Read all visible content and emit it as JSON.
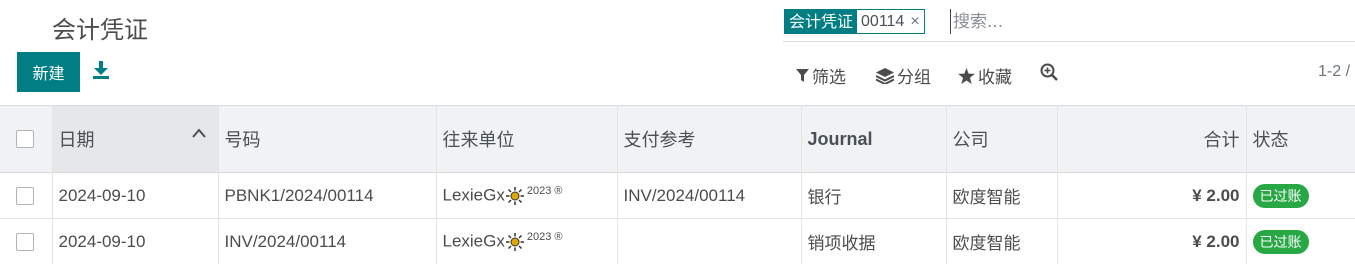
{
  "page": {
    "title": "会计凭证"
  },
  "search": {
    "facet_label": "会计凭证",
    "facet_value": "00114",
    "facet_close": "×",
    "placeholder": "搜索..."
  },
  "toolbar": {
    "new_label": "新建",
    "filters_label": "筛选",
    "groupby_label": "分组",
    "favorites_label": "收藏",
    "pager": "1-2 /"
  },
  "table": {
    "columns": {
      "date": "日期",
      "number": "号码",
      "partner": "往来单位",
      "payment_ref": "支付参考",
      "journal": "Journal",
      "company": "公司",
      "total": "合计",
      "state": "状态"
    },
    "rows": [
      {
        "date": "2024-09-10",
        "number": "PBNK1/2024/00114",
        "partner_name": "LexieGx",
        "partner_suffix": "2023 ®",
        "payment_ref": "INV/2024/00114",
        "journal": "银行",
        "company": "欧度智能",
        "total": "¥ 2.00",
        "state": "已过账"
      },
      {
        "date": "2024-09-10",
        "number": "INV/2024/00114",
        "partner_name": "LexieGx",
        "partner_suffix": "2023 ®",
        "payment_ref": "",
        "journal": "销项收据",
        "company": "欧度智能",
        "total": "¥ 2.00",
        "state": "已过账"
      }
    ]
  },
  "colors": {
    "primary": "#017e84",
    "posted_badge": "#28a745",
    "header_bg": "#f1f2f3"
  },
  "icons": [
    "download-icon",
    "filter-icon",
    "layers-icon",
    "star-icon",
    "search-plus-icon",
    "chevron-up-icon",
    "sun-icon"
  ]
}
